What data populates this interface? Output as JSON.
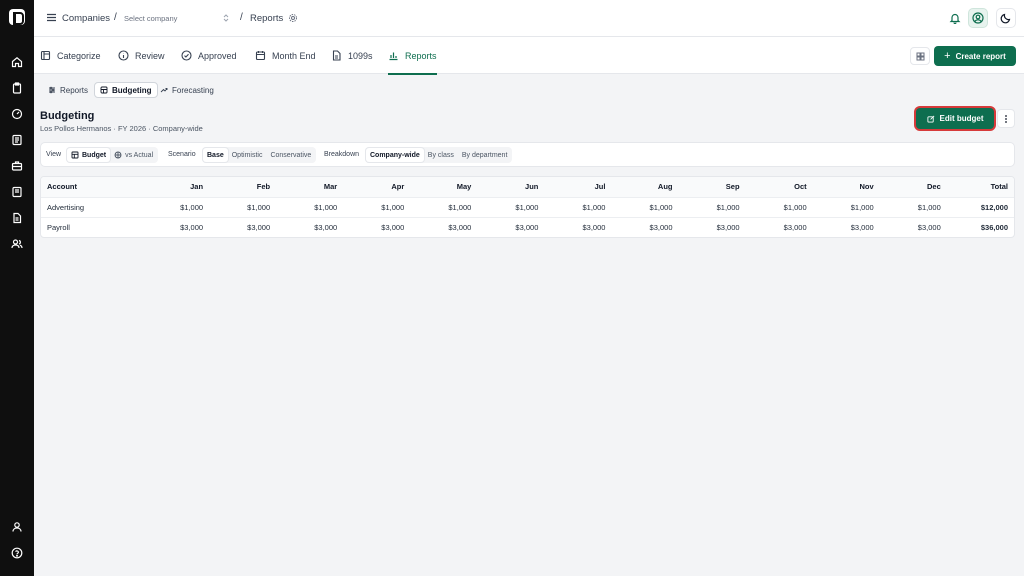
{
  "topbar": {
    "crumb_companies": "Companies",
    "sep1": "/",
    "select_company_placeholder": "Select company",
    "sep2": "/",
    "crumb_reports": "Reports"
  },
  "nav": {
    "tabs": [
      {
        "label": "Categorize",
        "icon": "categorize-icon"
      },
      {
        "label": "Review",
        "icon": "info-circle-icon"
      },
      {
        "label": "Approved",
        "icon": "check-circle-icon"
      },
      {
        "label": "Month End",
        "icon": "calendar-icon"
      },
      {
        "label": "1099s",
        "icon": "document-icon"
      },
      {
        "label": "Reports",
        "icon": "bar-chart-icon",
        "active": true
      }
    ],
    "create_report_label": "Create report"
  },
  "subtabs": [
    {
      "label": "Reports",
      "icon": "list-settings-icon"
    },
    {
      "label": "Budgeting",
      "icon": "budget-icon",
      "active": true
    },
    {
      "label": "Forecasting",
      "icon": "trend-icon"
    }
  ],
  "header": {
    "title": "Budgeting",
    "subtitle": "Los Pollos Hermanos · FY 2026 · Company-wide",
    "edit_budget_label": "Edit budget"
  },
  "filters": {
    "view_label": "View",
    "view_options": [
      "Budget",
      "vs Actual"
    ],
    "scenario_label": "Scenario",
    "scenario_options": [
      "Base",
      "Optimistic",
      "Conservative"
    ],
    "breakdown_label": "Breakdown",
    "breakdown_options": [
      "Company-wide",
      "By class",
      "By department"
    ]
  },
  "table": {
    "headers": [
      "Account",
      "Jan",
      "Feb",
      "Mar",
      "Apr",
      "May",
      "Jun",
      "Jul",
      "Aug",
      "Sep",
      "Oct",
      "Nov",
      "Dec",
      "Total"
    ],
    "rows": [
      [
        "Advertising",
        "$1,000",
        "$1,000",
        "$1,000",
        "$1,000",
        "$1,000",
        "$1,000",
        "$1,000",
        "$1,000",
        "$1,000",
        "$1,000",
        "$1,000",
        "$1,000",
        "$12,000"
      ],
      [
        "Payroll",
        "$3,000",
        "$3,000",
        "$3,000",
        "$3,000",
        "$3,000",
        "$3,000",
        "$3,000",
        "$3,000",
        "$3,000",
        "$3,000",
        "$3,000",
        "$3,000",
        "$36,000"
      ]
    ]
  },
  "colors": {
    "brand": "#0e6e4f",
    "highlight": "#d63a3a",
    "sidebar": "#0f0f0f"
  }
}
